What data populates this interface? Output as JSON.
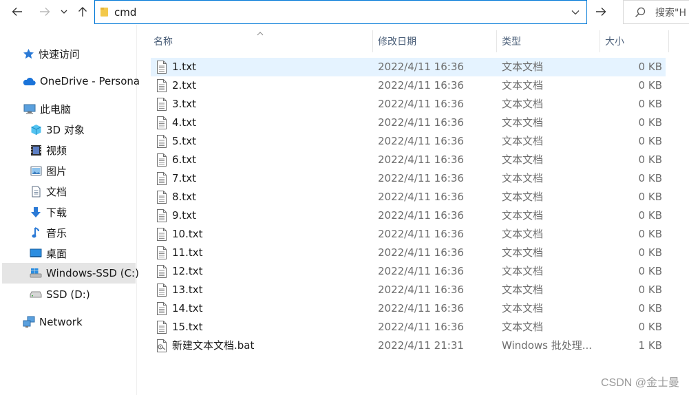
{
  "address": {
    "path": "cmd"
  },
  "search": {
    "placeholder": "搜索\"H"
  },
  "columns": {
    "name": "名称",
    "date": "修改日期",
    "type": "类型",
    "size": "大小"
  },
  "sidebar": {
    "items": [
      {
        "label": "快速访问",
        "icon": "star-icon"
      },
      {
        "label": "OneDrive - Persona",
        "icon": "cloud-icon"
      },
      {
        "label": "此电脑",
        "icon": "computer-icon"
      },
      {
        "label": "3D 对象",
        "icon": "cube-icon"
      },
      {
        "label": "视频",
        "icon": "video-icon"
      },
      {
        "label": "图片",
        "icon": "picture-icon"
      },
      {
        "label": "文档",
        "icon": "document-icon"
      },
      {
        "label": "下载",
        "icon": "download-arrow-icon"
      },
      {
        "label": "音乐",
        "icon": "music-note-icon"
      },
      {
        "label": "桌面",
        "icon": "desktop-icon"
      },
      {
        "label": "Windows-SSD (C:)",
        "icon": "windows-drive-icon",
        "selected": true
      },
      {
        "label": "SSD (D:)",
        "icon": "drive-icon"
      },
      {
        "label": "Network",
        "icon": "network-icon"
      }
    ]
  },
  "files": [
    {
      "name": "1.txt",
      "date": "2022/4/11 16:36",
      "type": "文本文档",
      "size": "0 KB",
      "selected": true
    },
    {
      "name": "2.txt",
      "date": "2022/4/11 16:36",
      "type": "文本文档",
      "size": "0 KB"
    },
    {
      "name": "3.txt",
      "date": "2022/4/11 16:36",
      "type": "文本文档",
      "size": "0 KB"
    },
    {
      "name": "4.txt",
      "date": "2022/4/11 16:36",
      "type": "文本文档",
      "size": "0 KB"
    },
    {
      "name": "5.txt",
      "date": "2022/4/11 16:36",
      "type": "文本文档",
      "size": "0 KB"
    },
    {
      "name": "6.txt",
      "date": "2022/4/11 16:36",
      "type": "文本文档",
      "size": "0 KB"
    },
    {
      "name": "7.txt",
      "date": "2022/4/11 16:36",
      "type": "文本文档",
      "size": "0 KB"
    },
    {
      "name": "8.txt",
      "date": "2022/4/11 16:36",
      "type": "文本文档",
      "size": "0 KB"
    },
    {
      "name": "9.txt",
      "date": "2022/4/11 16:36",
      "type": "文本文档",
      "size": "0 KB"
    },
    {
      "name": "10.txt",
      "date": "2022/4/11 16:36",
      "type": "文本文档",
      "size": "0 KB"
    },
    {
      "name": "11.txt",
      "date": "2022/4/11 16:36",
      "type": "文本文档",
      "size": "0 KB"
    },
    {
      "name": "12.txt",
      "date": "2022/4/11 16:36",
      "type": "文本文档",
      "size": "0 KB"
    },
    {
      "name": "13.txt",
      "date": "2022/4/11 16:36",
      "type": "文本文档",
      "size": "0 KB"
    },
    {
      "name": "14.txt",
      "date": "2022/4/11 16:36",
      "type": "文本文档",
      "size": "0 KB"
    },
    {
      "name": "15.txt",
      "date": "2022/4/11 16:36",
      "type": "文本文档",
      "size": "0 KB"
    },
    {
      "name": "新建文本文档.bat",
      "date": "2022/4/11 21:31",
      "type": "Windows 批处理...",
      "size": "1 KB",
      "kind": "bat"
    }
  ],
  "watermark": "CSDN @金士曼",
  "colors": {
    "accent": "#0078d7",
    "selected_row": "#e5f3ff",
    "selected_nav": "#e5e5e5",
    "header_text": "#4c607a"
  }
}
